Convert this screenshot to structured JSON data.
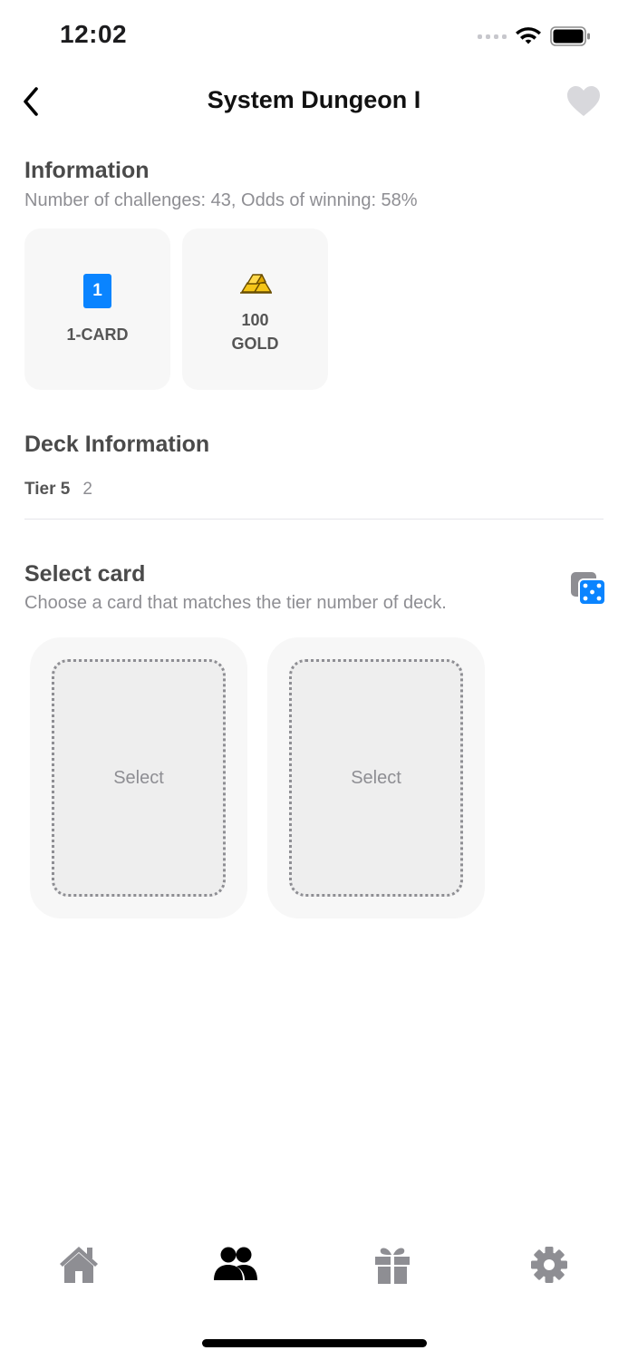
{
  "status_bar": {
    "time": "12:02"
  },
  "nav": {
    "title": "System Dungeon I"
  },
  "information": {
    "title": "Information",
    "subtitle": "Number of challenges: 43, Odds of winning: 58%",
    "rewards": [
      {
        "badge": "1",
        "label": "1-CARD",
        "icon": "card-icon"
      },
      {
        "amount": "100",
        "unit": "GOLD",
        "icon": "gold-bars-icon"
      }
    ]
  },
  "deck": {
    "title": "Deck Information",
    "tier_label": "Tier 5",
    "tier_count": "2"
  },
  "select": {
    "title": "Select card",
    "subtitle": "Choose a card that matches the tier number of deck.",
    "slot1_label": "Select",
    "slot2_label": "Select"
  },
  "tabbar": {
    "tabs": [
      {
        "icon": "home-icon",
        "active": false
      },
      {
        "icon": "people-icon",
        "active": true
      },
      {
        "icon": "gift-icon",
        "active": false
      },
      {
        "icon": "gear-icon",
        "active": false
      }
    ]
  },
  "colors": {
    "accent": "#0a84ff",
    "gold": "#f5c518",
    "inactive_icon": "#8e8e93"
  }
}
